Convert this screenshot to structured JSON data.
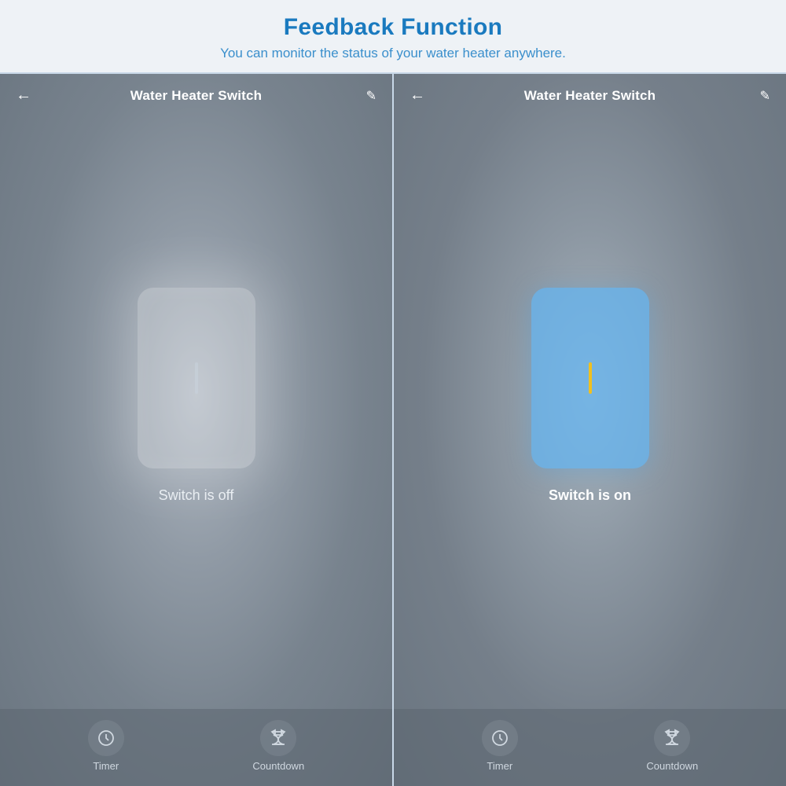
{
  "header": {
    "title": "Feedback Function",
    "subtitle": "You can monitor the status of your water heater anywhere."
  },
  "screens": [
    {
      "id": "off",
      "topBar": {
        "title": "Water Heater Switch",
        "backLabel": "←",
        "editLabel": "✎"
      },
      "switchState": "off",
      "switchLabel": "Switch is off",
      "bottomBar": {
        "timer": {
          "label": "Timer"
        },
        "countdown": {
          "label": "Countdown"
        }
      }
    },
    {
      "id": "on",
      "topBar": {
        "title": "Water Heater Switch",
        "backLabel": "←",
        "editLabel": "✎"
      },
      "switchState": "on",
      "switchLabel": "Switch is on",
      "bottomBar": {
        "timer": {
          "label": "Timer"
        },
        "countdown": {
          "label": "Countdown"
        }
      }
    }
  ],
  "colors": {
    "accent": "#1a7abf",
    "subtitle": "#3a8fcc"
  }
}
